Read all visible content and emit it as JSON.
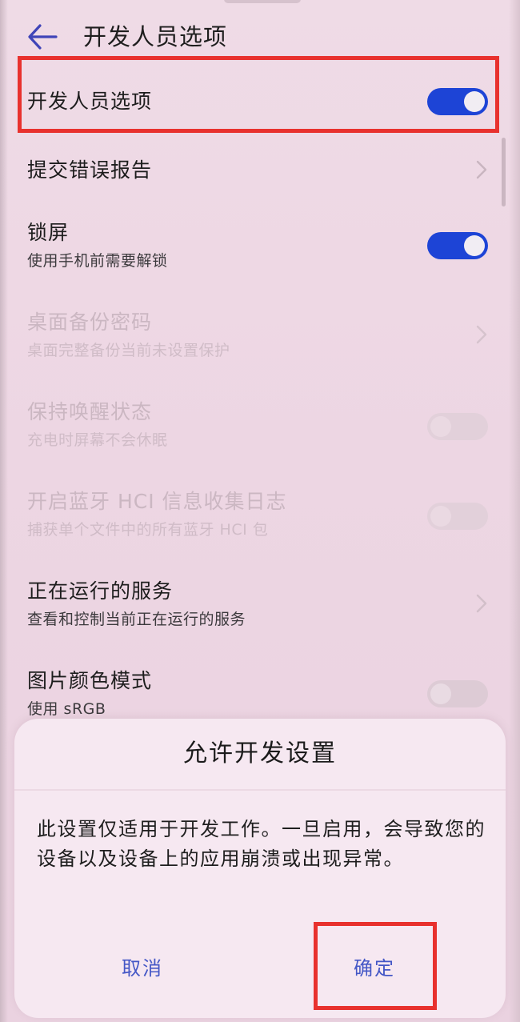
{
  "header": {
    "title": "开发人员选项"
  },
  "settings": [
    {
      "title": "开发人员选项",
      "subtitle": "",
      "control": "toggle",
      "state": "on",
      "enabled": true
    },
    {
      "title": "提交错误报告",
      "subtitle": "",
      "control": "chevron",
      "enabled": true
    },
    {
      "title": "锁屏",
      "subtitle": "使用手机前需要解锁",
      "control": "toggle",
      "state": "on",
      "enabled": true
    },
    {
      "title": "桌面备份密码",
      "subtitle": "桌面完整备份当前未设置保护",
      "control": "chevron",
      "enabled": false
    },
    {
      "title": "保持唤醒状态",
      "subtitle": "充电时屏幕不会休眠",
      "control": "toggle",
      "state": "off",
      "enabled": false
    },
    {
      "title": "开启蓝牙 HCI 信息收集日志",
      "subtitle": "捕获单个文件中的所有蓝牙 HCI 包",
      "control": "toggle",
      "state": "off",
      "enabled": false
    },
    {
      "title": "正在运行的服务",
      "subtitle": "查看和控制当前正在运行的服务",
      "control": "chevron",
      "enabled": true
    },
    {
      "title": "图片颜色模式",
      "subtitle": "使用 sRGB",
      "control": "toggle",
      "state": "off",
      "enabled": true
    }
  ],
  "dialog": {
    "title": "允许开发设置",
    "message": "此设置仅适用于开发工作。一旦启用，会导致您的设备以及设备上的应用崩溃或出现异常。",
    "cancel_label": "取消",
    "confirm_label": "确定"
  },
  "colors": {
    "accent": "#1d44d6",
    "button_text": "#4457c6",
    "highlight": "#e8312e",
    "background": "#edd6e3"
  },
  "icons": {
    "back": "back-arrow-icon",
    "chevron": "chevron-right-icon"
  }
}
